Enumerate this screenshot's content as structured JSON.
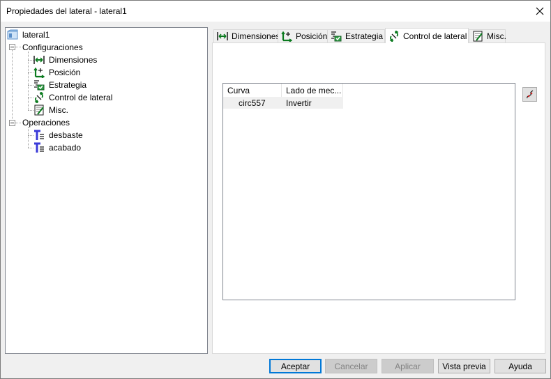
{
  "window": {
    "title": "Propiedades del lateral - lateral1"
  },
  "tree": {
    "root": {
      "label": "lateral1",
      "icon": "lateral-icon"
    },
    "configuraciones": {
      "label": "Configuraciones",
      "children": [
        {
          "label": "Dimensiones",
          "icon": "dimensions-icon"
        },
        {
          "label": "Posición",
          "icon": "position-icon"
        },
        {
          "label": "Estrategia",
          "icon": "strategy-icon"
        },
        {
          "label": "Control de lateral",
          "icon": "side-control-icon"
        },
        {
          "label": "Misc.",
          "icon": "misc-icon"
        }
      ]
    },
    "operaciones": {
      "label": "Operaciones",
      "children": [
        {
          "label": "desbaste",
          "icon": "tool-operation-icon"
        },
        {
          "label": "acabado",
          "icon": "tool-operation-icon"
        }
      ]
    }
  },
  "tabs": [
    {
      "label": "Dimensiones",
      "icon": "dimensions-icon",
      "active": false
    },
    {
      "label": "Posición",
      "icon": "position-icon",
      "active": false
    },
    {
      "label": "Estrategia",
      "icon": "strategy-icon",
      "active": false
    },
    {
      "label": "Control de lateral",
      "icon": "side-control-icon",
      "active": true
    },
    {
      "label": "Misc.",
      "icon": "misc-icon",
      "active": false
    }
  ],
  "list": {
    "columns": [
      "Curva",
      "Lado de mec..."
    ],
    "rows": [
      {
        "curva": "circ557",
        "lado": "Invertir"
      }
    ]
  },
  "side_button": {
    "icon": "curve-select-icon"
  },
  "buttons": {
    "accept": "Aceptar",
    "cancel": "Cancelar",
    "apply": "Aplicar",
    "preview": "Vista previa",
    "help": "Ayuda"
  },
  "colors": {
    "accent": "#0078d7",
    "selected_row": "#f0f0f0"
  }
}
